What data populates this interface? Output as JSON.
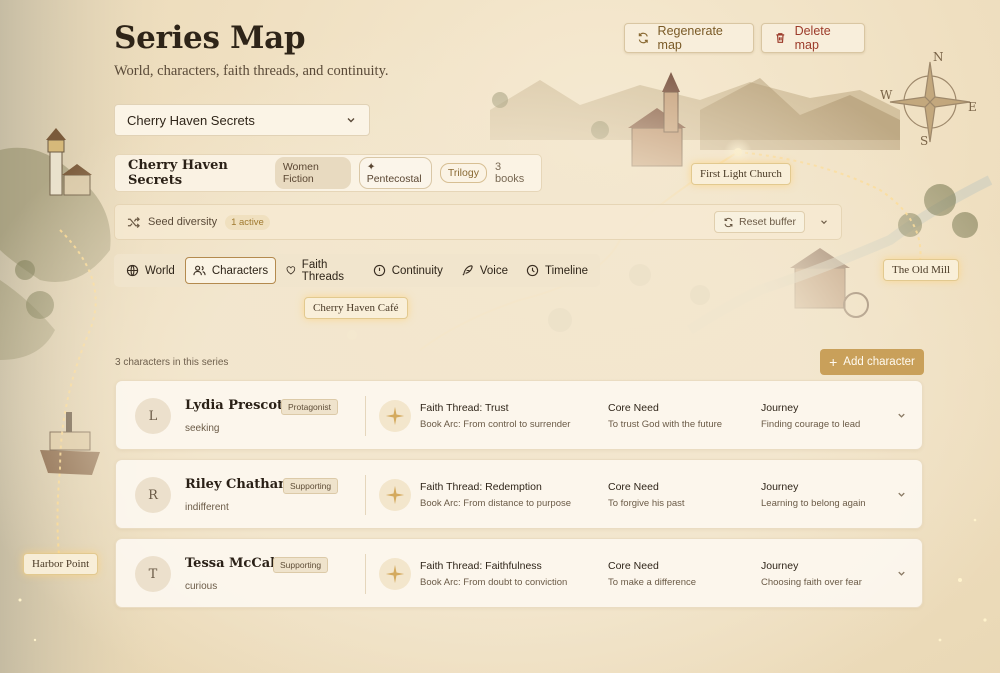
{
  "header": {
    "title": "Series Map",
    "subtitle": "World, characters, faith threads, and continuity.",
    "regenerate_label": "Regenerate map",
    "delete_label": "Delete map"
  },
  "series_select": {
    "value": "Cherry Haven Secrets"
  },
  "series": {
    "name": "Cherry Haven Secrets",
    "genre": "Women Fiction",
    "tradition": "✦ Pentecostal",
    "format": "Trilogy",
    "book_count": "3 books"
  },
  "seed": {
    "label": "Seed diversity",
    "active": "1 active",
    "reset_label": "Reset buffer"
  },
  "tabs": [
    {
      "label": "World",
      "icon": "globe-icon"
    },
    {
      "label": "Characters",
      "icon": "users-icon",
      "active": true
    },
    {
      "label": "Faith Threads",
      "icon": "heart-icon"
    },
    {
      "label": "Continuity",
      "icon": "alert-circle-icon"
    },
    {
      "label": "Voice",
      "icon": "quill-icon"
    },
    {
      "label": "Timeline",
      "icon": "clock-icon"
    }
  ],
  "characters_section": {
    "count_text": "3 characters in this series",
    "add_label": "Add character"
  },
  "labels": {
    "core_need": "Core Need",
    "journey": "Journey"
  },
  "characters": [
    {
      "initial": "L",
      "name": "Lydia Prescott",
      "role": "Protagonist",
      "status": "seeking",
      "faith_thread": "Faith Thread: Trust",
      "book_arc": "Book Arc: From control to surrender",
      "core_need": "To trust God with the future",
      "journey": "Finding courage to lead"
    },
    {
      "initial": "R",
      "name": "Riley Chatham",
      "role": "Supporting",
      "status": "indifferent",
      "faith_thread": "Faith Thread: Redemption",
      "book_arc": "Book Arc: From distance to purpose",
      "core_need": "To forgive his past",
      "journey": "Learning to belong again"
    },
    {
      "initial": "T",
      "name": "Tessa McCall",
      "role": "Supporting",
      "status": "curious",
      "faith_thread": "Faith Thread: Faithfulness",
      "book_arc": "Book Arc: From doubt to conviction",
      "core_need": "To make a difference",
      "journey": "Choosing faith over fear"
    }
  ],
  "map_labels": {
    "church": "First Light Church",
    "mill": "The Old Mill",
    "cafe": "Cherry Haven Café",
    "harbor": "Harbor Point"
  },
  "compass": {
    "n": "N",
    "s": "S",
    "e": "E",
    "w": "W"
  },
  "colors": {
    "accent": "#c9a05a",
    "danger": "#9c3b2a",
    "active_tab_border": "#b48a4e"
  }
}
